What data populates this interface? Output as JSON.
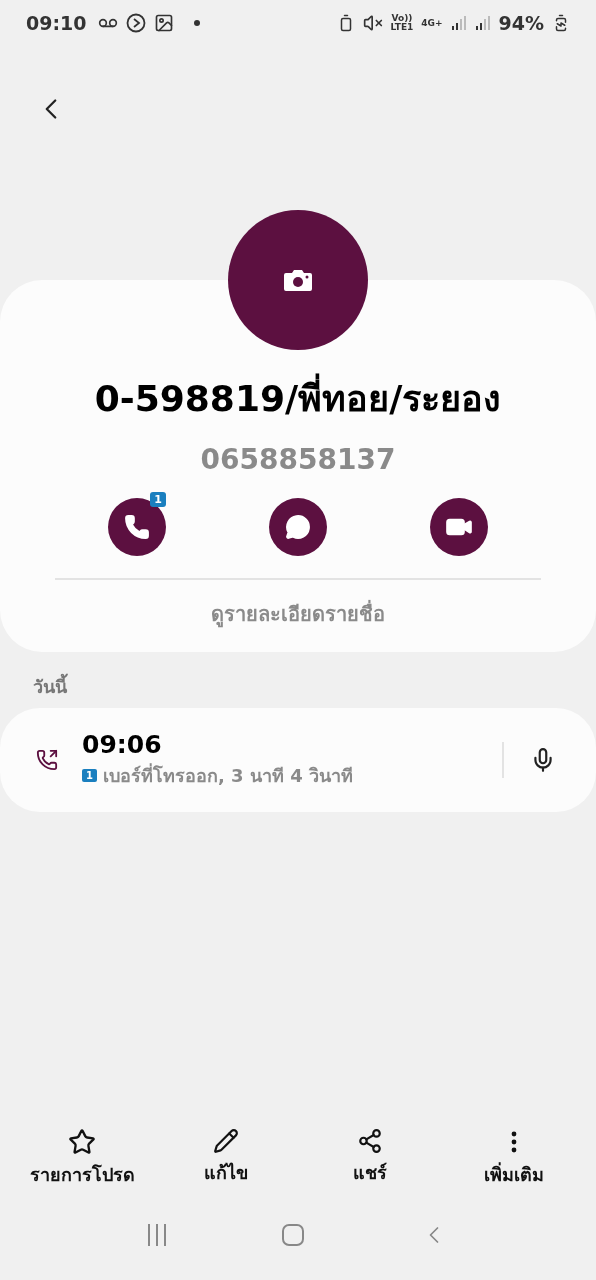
{
  "status_bar": {
    "time": "09:10",
    "volte": "Vo))",
    "lte": "LTE1",
    "network": "4G+",
    "battery": "94%"
  },
  "contact": {
    "name": "0-598819/พี่ทอย/ระยอง",
    "phone": "0658858137",
    "view_details": "ดูรายละเอียดรายชื่อ"
  },
  "actions": [
    {
      "kind": "call",
      "badge": "1"
    },
    {
      "kind": "message"
    },
    {
      "kind": "video"
    }
  ],
  "history": {
    "heading": "วันนี้",
    "entries": [
      {
        "kind": "outgoing",
        "time": "09:06",
        "sim": "1",
        "detail": "เบอร์ที่โทรออก, 3 นาที 4 วินาที"
      }
    ]
  },
  "bottom_bar": [
    {
      "kind": "star",
      "label": "รายการโปรด"
    },
    {
      "kind": "edit",
      "label": "แก้ไข"
    },
    {
      "kind": "share",
      "label": "แชร์"
    },
    {
      "kind": "more",
      "label": "เพิ่มเติม"
    }
  ]
}
